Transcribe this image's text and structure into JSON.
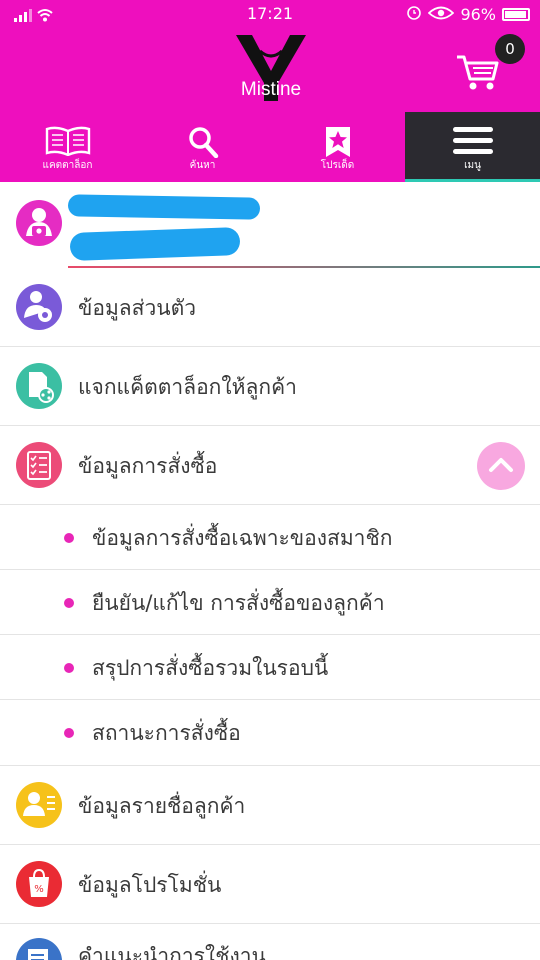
{
  "status": {
    "time": "17:21",
    "battery": "96%"
  },
  "header": {
    "logo_text": "Mistine",
    "cart_count": "0"
  },
  "nav": [
    {
      "label": "แคตตาล็อก",
      "icon": "catalog-book-icon"
    },
    {
      "label": "ค้นหา",
      "icon": "search-icon"
    },
    {
      "label": "โปรเด็ด",
      "icon": "star-bookmark-icon"
    },
    {
      "label": "เมนู",
      "icon": "hamburger-menu-icon"
    }
  ],
  "menu": {
    "personal": "ข้อมูลส่วนตัว",
    "share_catalog": "แจกแค็ตตาล็อกให้ลูกค้า",
    "orders": "ข้อมูลการสั่งซื้อ",
    "order_sub": [
      "ข้อมูลการสั่งซื้อเฉพาะของสมาชิก",
      "ยืนยัน/แก้ไข การสั่งซื้อของลูกค้า",
      "สรุปการสั่งซื้อรวมในรอบนี้",
      "สถานะการสั่งซื้อ"
    ],
    "customers": "ข้อมูลรายชื่อลูกค้า",
    "promotions": "ข้อมูลโปรโมชั่น",
    "guide": "คำแนะนำการใช้งาน"
  },
  "colors": {
    "brand": "#ee0fbe",
    "active_nav": "#2b2a30",
    "accent_teal": "#2ec9b4"
  }
}
